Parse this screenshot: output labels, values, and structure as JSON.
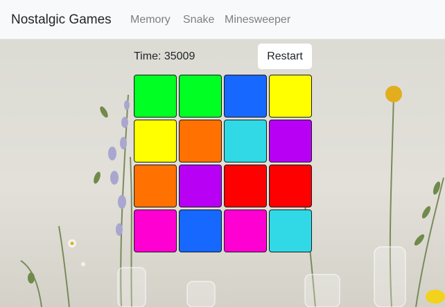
{
  "nav": {
    "brand": "Nostalgic Games",
    "links": [
      "Memory",
      "Snake",
      "Minesweeper"
    ]
  },
  "game": {
    "time_label": "Time: 35009",
    "restart_label": "Restart"
  },
  "colors": {
    "green": "#00ff22",
    "blue": "#1668ff",
    "yellow": "#ffff00",
    "orange": "#ff7100",
    "cyan": "#30d9e5",
    "purple": "#b800f5",
    "red": "#ff0000",
    "magenta": "#ff00d2"
  },
  "board": [
    [
      "green",
      "green",
      "blue",
      "yellow"
    ],
    [
      "yellow",
      "orange",
      "cyan",
      "purple"
    ],
    [
      "orange",
      "purple",
      "red",
      "red"
    ],
    [
      "magenta",
      "blue",
      "magenta",
      "cyan"
    ]
  ]
}
